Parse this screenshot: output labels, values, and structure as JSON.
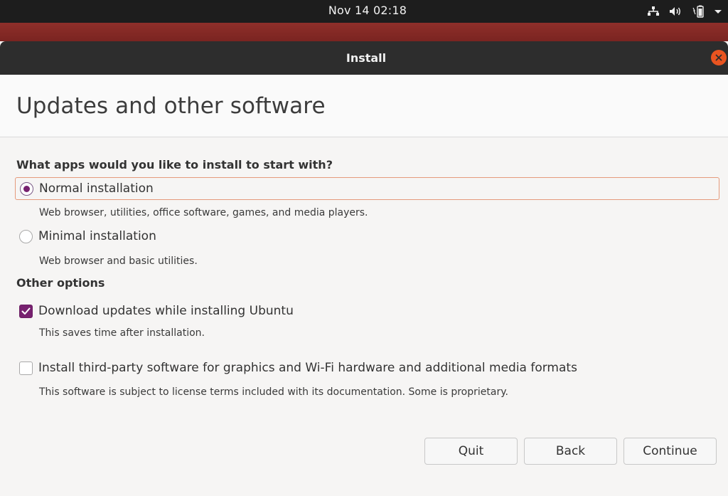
{
  "top_panel": {
    "clock": "Nov 14  02:18",
    "icons": [
      "network-icon",
      "volume-icon",
      "battery-icon",
      "system-menu-arrow-icon"
    ]
  },
  "window": {
    "title": "Install",
    "close_icon": "close-icon"
  },
  "page": {
    "title": "Updates and other software"
  },
  "apps_section": {
    "heading": "What apps would you like to install to start with?",
    "options": [
      {
        "label": "Normal installation",
        "description": "Web browser, utilities, office software, games, and media players.",
        "selected": true
      },
      {
        "label": "Minimal installation",
        "description": "Web browser and basic utilities.",
        "selected": false
      }
    ]
  },
  "other_section": {
    "heading": "Other options",
    "options": [
      {
        "label": "Download updates while installing Ubuntu",
        "description": "This saves time after installation.",
        "checked": true
      },
      {
        "label": "Install third-party software for graphics and Wi-Fi hardware and additional media formats",
        "description": "This software is subject to license terms included with its documentation. Some is proprietary.",
        "checked": false
      }
    ]
  },
  "buttons": {
    "quit": "Quit",
    "back": "Back",
    "continue": "Continue"
  },
  "colors": {
    "accent": "#77216f",
    "close": "#e95420",
    "focus_border": "#e59a7c"
  }
}
